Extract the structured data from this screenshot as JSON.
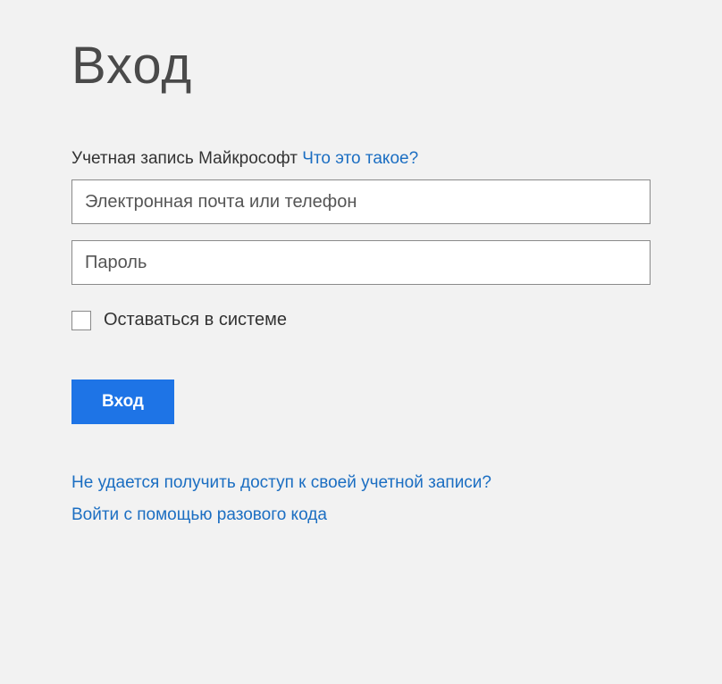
{
  "title": "Вход",
  "account": {
    "label": "Учетная запись Майкрософт",
    "whats_this": "Что это такое?"
  },
  "inputs": {
    "email_placeholder": "Электронная почта или телефон",
    "password_placeholder": "Пароль"
  },
  "checkbox": {
    "label": "Оставаться в системе"
  },
  "signin_button": "Вход",
  "links": {
    "cant_access": "Не удается получить доступ к своей учетной записи?",
    "onetime_code": "Войти с помощью разового кода"
  }
}
